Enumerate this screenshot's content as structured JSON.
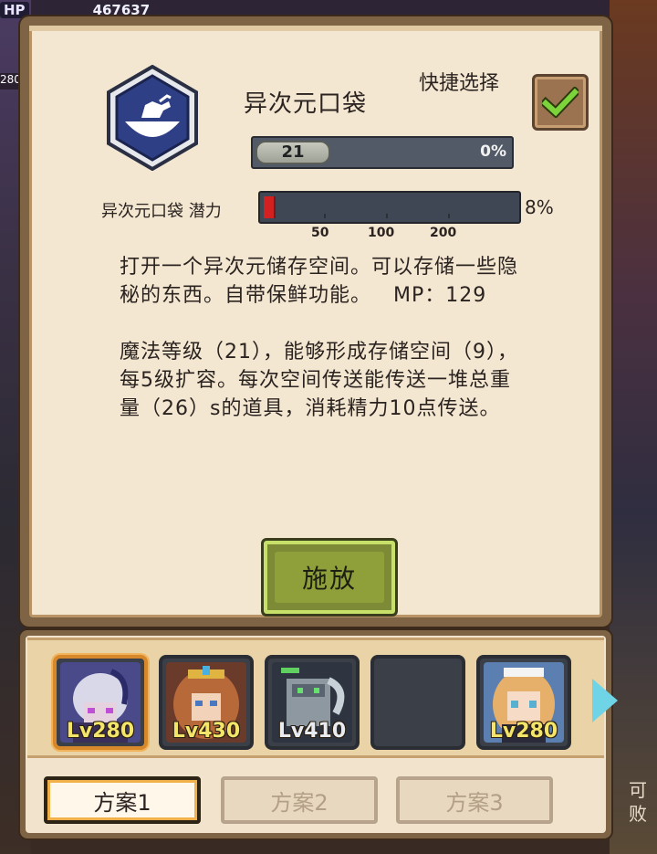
{
  "hud": {
    "hp_label": "HP",
    "hp_value": "467637",
    "side_number": "280"
  },
  "side_text": "可\n败",
  "skill": {
    "title": "异次元口袋",
    "icon": "hand-in-bowl-icon",
    "level": "21",
    "level_progress": "0%",
    "level_progress_value": 0,
    "potential_label": "异次元口袋 潜力",
    "potential_percent": "8%",
    "potential_value": 0.08,
    "potential_marks": [
      "50",
      "100",
      "200"
    ]
  },
  "quick_select": {
    "label": "快捷选择",
    "checked": true,
    "icon": "checkmark-icon"
  },
  "description": {
    "para1_line1": "打开一个异次元储存空间。可以存储一些隐",
    "para1_line2": "秘的东西。自带保鲜功能。   MP：129",
    "para2_line1": "魔法等级（21），能够形成存储空间（9），",
    "para2_line2": "每5级扩容。每次空间传送能传送一堆总重",
    "para2_line3": "量（26）s的道具，消耗精力10点传送。"
  },
  "cast_button": {
    "label": "施放"
  },
  "team": {
    "members": [
      {
        "level": "Lv280",
        "selected": true,
        "color": "#6b5fb0"
      },
      {
        "level": "Lv430",
        "selected": false,
        "color": "#b86a3a"
      },
      {
        "level": "Lv410",
        "selected": false,
        "color": "#4a5a4a"
      },
      {
        "level": "",
        "selected": false,
        "color": "#3a3f48"
      },
      {
        "level": "Lv280",
        "selected": false,
        "color": "#5a8cc0"
      }
    ]
  },
  "plans": [
    {
      "label": "方案1",
      "active": true
    },
    {
      "label": "方案2",
      "active": false
    },
    {
      "label": "方案3",
      "active": false
    }
  ],
  "colors": {
    "dialog_bg": "#f3e7d2",
    "frame": "#7e6445",
    "cast_green": "#8fa03a",
    "potential_red": "#d42020"
  }
}
